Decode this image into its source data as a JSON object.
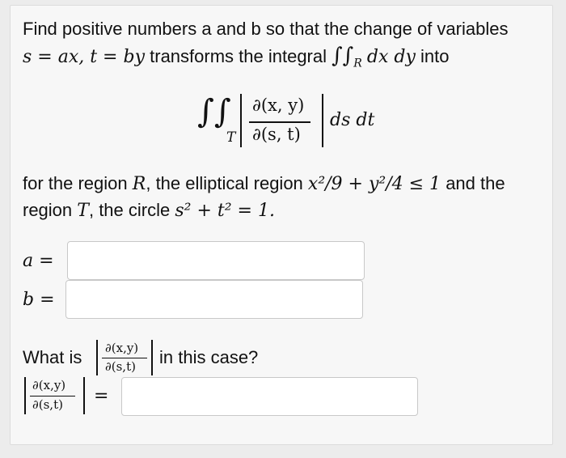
{
  "problem": {
    "line1": "Find positive numbers a and b so that the change of variables",
    "line2_text1": "transforms the integral",
    "line2_text2": "into",
    "line3_text1": "for the region",
    "line3_text2": ", the elliptical region",
    "line3_text3": "and the",
    "line4_text1": "region",
    "line4_text2": ", the circle"
  },
  "math": {
    "var_a": "a",
    "var_b": "b",
    "subst": "s = ax, t = by",
    "region_R": "R",
    "region_T": "T",
    "dxdy": "dx dy",
    "dsdt": "ds dt",
    "jac_num": "∂(x, y)",
    "jac_den": "∂(s, t)",
    "jac_num_small": "∂(x,y)",
    "jac_den_small": "∂(s,t)",
    "ellipse": "x²/9 + y²/4 ≤ 1",
    "circle": "s² + t² = 1."
  },
  "questions": {
    "a_label": "a =",
    "b_label": "b =",
    "jac_question_pre": "What is",
    "jac_question_post": "in this case?",
    "jac_equals": "="
  },
  "inputs": {
    "a_value": "",
    "b_value": "",
    "jac_value": ""
  }
}
